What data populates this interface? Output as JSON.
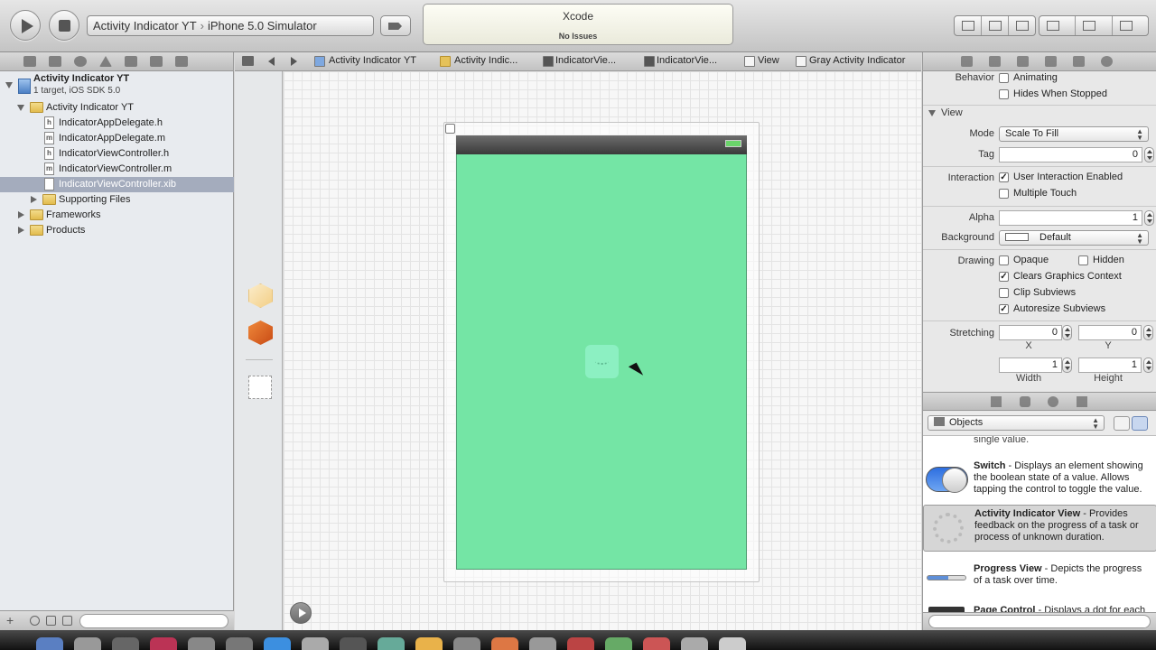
{
  "toolbar": {
    "scheme_target": "Activity Indicator YT",
    "scheme_destination": "iPhone 5.0 Simulator",
    "activity_title": "Xcode",
    "activity_status": "No Issues"
  },
  "navigator": {
    "project_name": "Activity Indicator YT",
    "project_sub": "1 target, iOS SDK 5.0",
    "items": [
      {
        "label": "Activity Indicator YT",
        "kind": "folder"
      },
      {
        "label": "IndicatorAppDelegate.h",
        "kind": "h"
      },
      {
        "label": "IndicatorAppDelegate.m",
        "kind": "m"
      },
      {
        "label": "IndicatorViewController.h",
        "kind": "h"
      },
      {
        "label": "IndicatorViewController.m",
        "kind": "m"
      },
      {
        "label": "IndicatorViewController.xib",
        "kind": "xib",
        "selected": true
      },
      {
        "label": "Supporting Files",
        "kind": "folder"
      },
      {
        "label": "Frameworks",
        "kind": "folder"
      },
      {
        "label": "Products",
        "kind": "folder"
      }
    ]
  },
  "jumpbar": {
    "crumbs": [
      "Activity Indicator YT",
      "Activity Indic...",
      "IndicatorVie...",
      "IndicatorVie...",
      "View",
      "Gray Activity Indicator"
    ]
  },
  "inspector": {
    "behavior_label": "Behavior",
    "animating": {
      "label": "Animating",
      "checked": false
    },
    "hides_when_stopped": {
      "label": "Hides When Stopped",
      "checked": false
    },
    "view_section": "View",
    "mode_label": "Mode",
    "mode_value": "Scale To Fill",
    "tag_label": "Tag",
    "tag_value": "0",
    "interaction_label": "Interaction",
    "user_interaction": {
      "label": "User Interaction Enabled",
      "checked": true
    },
    "multiple_touch": {
      "label": "Multiple Touch",
      "checked": false
    },
    "alpha_label": "Alpha",
    "alpha_value": "1",
    "background_label": "Background",
    "background_value": "Default",
    "drawing_label": "Drawing",
    "opaque": {
      "label": "Opaque",
      "checked": false
    },
    "hidden": {
      "label": "Hidden",
      "checked": false
    },
    "clears_graphics": {
      "label": "Clears Graphics Context",
      "checked": true
    },
    "clip_subviews": {
      "label": "Clip Subviews",
      "checked": false
    },
    "autoresize": {
      "label": "Autoresize Subviews",
      "checked": true
    },
    "stretching_label": "Stretching",
    "stretch_x": "0",
    "stretch_y": "0",
    "stretch_x_label": "X",
    "stretch_y_label": "Y",
    "stretch_w": "1",
    "stretch_h": "1",
    "width_label": "Width",
    "height_label": "Height"
  },
  "library": {
    "filter_value": "Objects",
    "partial_text": "single value.",
    "items": [
      {
        "title": "Switch",
        "desc": " - Displays an element showing the boolean state of a value. Allows tapping the control to toggle the value."
      },
      {
        "title": "Activity Indicator View",
        "desc": " - Provides feedback on the progress of a task or process of unknown duration."
      },
      {
        "title": "Progress View",
        "desc": " - Depicts the progress of a task over time."
      },
      {
        "title": "Page Control",
        "desc": " - Displays a dot for each"
      }
    ]
  },
  "colors": {
    "view_background": "#74e5a5",
    "selection": "#a4acbd"
  }
}
